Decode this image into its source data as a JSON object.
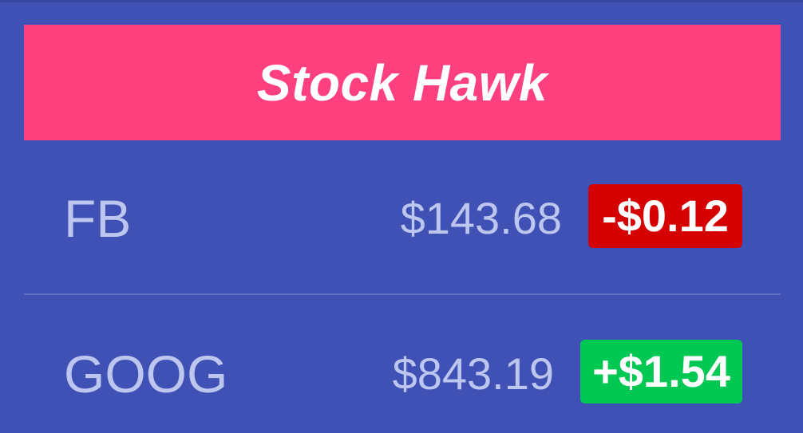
{
  "widget": {
    "title": "Stock Hawk"
  },
  "stocks": [
    {
      "symbol": "FB",
      "price": "$143.68",
      "change": "-$0.12",
      "direction": "down"
    },
    {
      "symbol": "GOOG",
      "price": "$843.19",
      "change": "+$1.54",
      "direction": "up"
    }
  ],
  "colors": {
    "background": "#3f51b5",
    "header": "#ff407f",
    "text": "#bcc6ee",
    "negative": "#d50000",
    "positive": "#00c853",
    "divider": "#6270c4"
  }
}
